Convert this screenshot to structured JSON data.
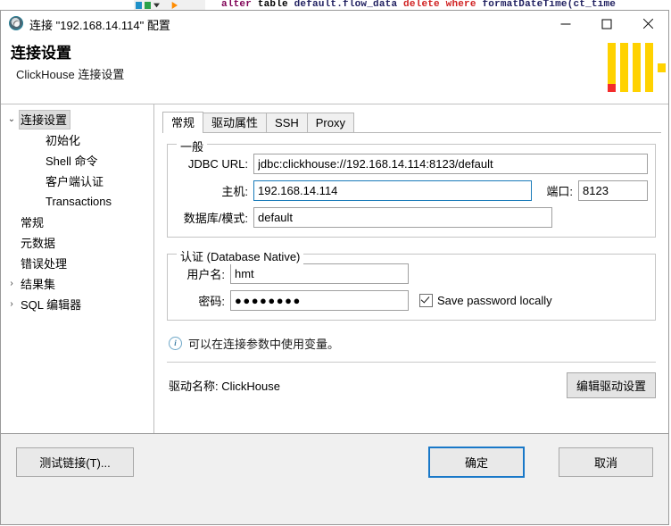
{
  "background": {
    "sql_parts": [
      {
        "text": "alter",
        "kind": "kw"
      },
      {
        "text": " table ",
        "kind": "plain"
      },
      {
        "text": "default.flow_data ",
        "kind": "id"
      },
      {
        "text": "delete where",
        "kind": "red"
      },
      {
        "text": " formatDateTime(ct_time",
        "kind": "fn"
      }
    ],
    "sql_full": "alter table default.flow_data delete where formatDateTime(ct_time"
  },
  "window": {
    "title": "连接 \"192.168.14.114\" 配置",
    "icon": "connection-icon",
    "minimize_label": "—",
    "maximize_label": "□",
    "close_label": "✕"
  },
  "banner": {
    "title": "连接设置",
    "subtitle": "ClickHouse 连接设置",
    "logo_colors": {
      "bar": "#ffd200",
      "accent": "#f32b2b"
    }
  },
  "sidebar": {
    "items": [
      {
        "label": "连接设置",
        "level": 0,
        "twisty": "⌄",
        "selected": true
      },
      {
        "label": "初始化",
        "level": 1,
        "twisty": "",
        "selected": false
      },
      {
        "label": "Shell 命令",
        "level": 1,
        "twisty": "",
        "selected": false
      },
      {
        "label": "客户端认证",
        "level": 1,
        "twisty": "",
        "selected": false
      },
      {
        "label": "Transactions",
        "level": 1,
        "twisty": "",
        "selected": false
      },
      {
        "label": "常规",
        "level": 0,
        "twisty": "",
        "selected": false
      },
      {
        "label": "元数据",
        "level": 0,
        "twisty": "",
        "selected": false
      },
      {
        "label": "错误处理",
        "level": 0,
        "twisty": "",
        "selected": false
      },
      {
        "label": "结果集",
        "level": 0,
        "twisty": "›",
        "selected": false
      },
      {
        "label": "SQL 编辑器",
        "level": 0,
        "twisty": "›",
        "selected": false
      }
    ]
  },
  "tabs": [
    {
      "label": "常规",
      "active": true
    },
    {
      "label": "驱动属性",
      "active": false
    },
    {
      "label": "SSH",
      "active": false
    },
    {
      "label": "Proxy",
      "active": false
    }
  ],
  "general_group": {
    "title": "一般",
    "jdbc_url_label": "JDBC URL:",
    "jdbc_url_value": "jdbc:clickhouse://192.168.14.114:8123/default",
    "host_label": "主机:",
    "host_value": "192.168.14.114",
    "port_label": "端口:",
    "port_value": "8123",
    "database_label": "数据库/模式:",
    "database_value": "default"
  },
  "auth_group": {
    "title": "认证 (Database Native)",
    "username_label": "用户名:",
    "username_value": "hmt",
    "password_label": "密码:",
    "password_value": "●●●●●●●●",
    "save_password_label": "Save password locally",
    "save_password_checked": true
  },
  "note": {
    "icon": "info-icon",
    "text": "可以在连接参数中使用变量。"
  },
  "driver": {
    "name_label": "驱动名称:",
    "name_value": "ClickHouse",
    "edit_button_label": "编辑驱动设置"
  },
  "footer": {
    "test_label": "测试链接(T)...",
    "ok_label": "确定",
    "cancel_label": "取消",
    "ok_accent_color": "#1978c8"
  }
}
